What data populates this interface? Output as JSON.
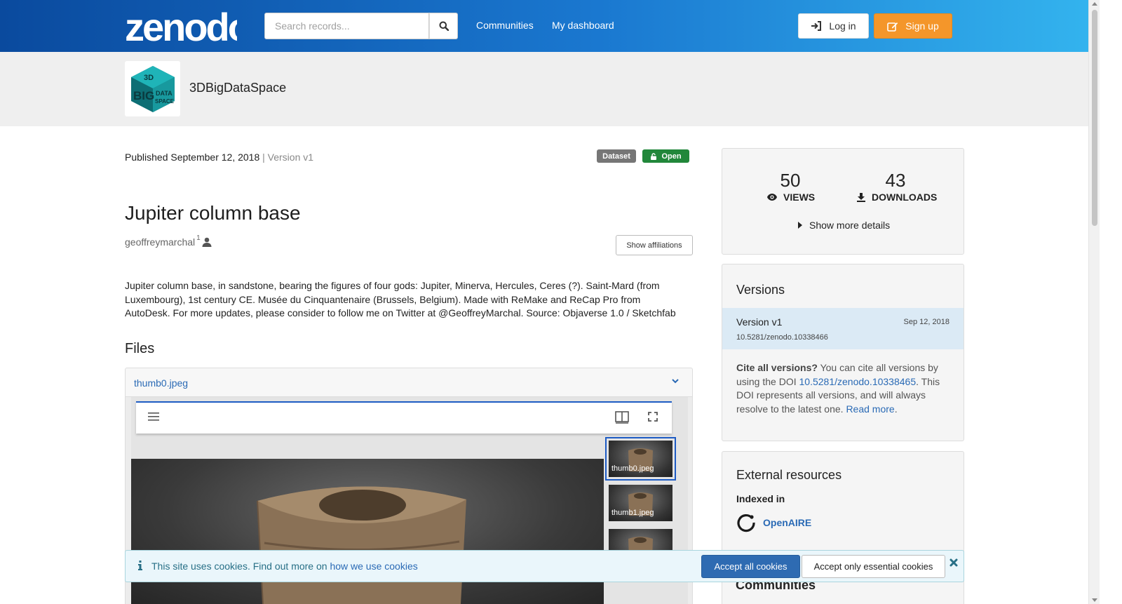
{
  "header": {
    "logo_text": "zenodo",
    "search_placeholder": "Search records...",
    "nav": [
      "Communities",
      "My dashboard"
    ],
    "login_label": "Log in",
    "signup_label": "Sign up"
  },
  "community": {
    "name": "3DBigDataSpace",
    "logo_lettering": [
      "3D",
      "BIG",
      "DATA",
      "SPACE"
    ]
  },
  "record": {
    "published": "Published September 12, 2018",
    "separator": "|",
    "version": "Version v1",
    "badges": {
      "type": "Dataset",
      "access": "Open"
    },
    "title": "Jupiter column base",
    "creator": "geoffreymarchal",
    "creator_affiliation_ref": "1",
    "show_affiliations_label": "Show affiliations",
    "description": "Jupiter column base, in sandstone, bearing the figures of four gods: Jupiter, Minerva, Hercules, Ceres (?). Saint-Mard (from Luxembourg), 1st century CE. Musée du Cinquantenaire (Brussels, Belgium). Made with ReMake and ReCap Pro from AutoDesk. For more updates, please consider to follow me on Twitter at @GeoffreyMarchal. Source: Objaverse 1.0 / Sketchfab",
    "files_heading": "Files",
    "file_name": "thumb0.jpeg",
    "thumbnails": [
      "thumb0.jpeg",
      "thumb1.jpeg",
      ""
    ]
  },
  "stats": {
    "views": "50",
    "views_label": "VIEWS",
    "downloads": "43",
    "downloads_label": "DOWNLOADS",
    "more_details_label": "Show more details"
  },
  "versions": {
    "heading": "Versions",
    "items": [
      {
        "name": "Version v1",
        "date": "Sep 12, 2018",
        "doi": "10.5281/zenodo.10338466"
      }
    ],
    "cite_bold": "Cite all versions?",
    "cite_text_1": " You can cite all versions by using the DOI ",
    "cite_doi": "10.5281/zenodo.10338465",
    "cite_text_2": ". This DOI represents all versions, and will always resolve to the latest one. ",
    "read_more": "Read more",
    "cite_text_3": "."
  },
  "external": {
    "heading": "External resources",
    "indexed_in": "Indexed in",
    "resource": "OpenAIRE",
    "communities_heading": "Communities"
  },
  "cookie": {
    "text": "This site uses cookies. Find out more on ",
    "link": "how we use cookies",
    "accept_all": "Accept all cookies",
    "accept_essential": "Accept only essential cookies"
  },
  "colors": {
    "header_gradient_start": "#0a4a9e",
    "header_gradient_end": "#33b3ee",
    "signup": "#f4962a",
    "open_badge": "#21873a",
    "link": "#2a6ab5",
    "accept_all": "#2e6bb2"
  }
}
